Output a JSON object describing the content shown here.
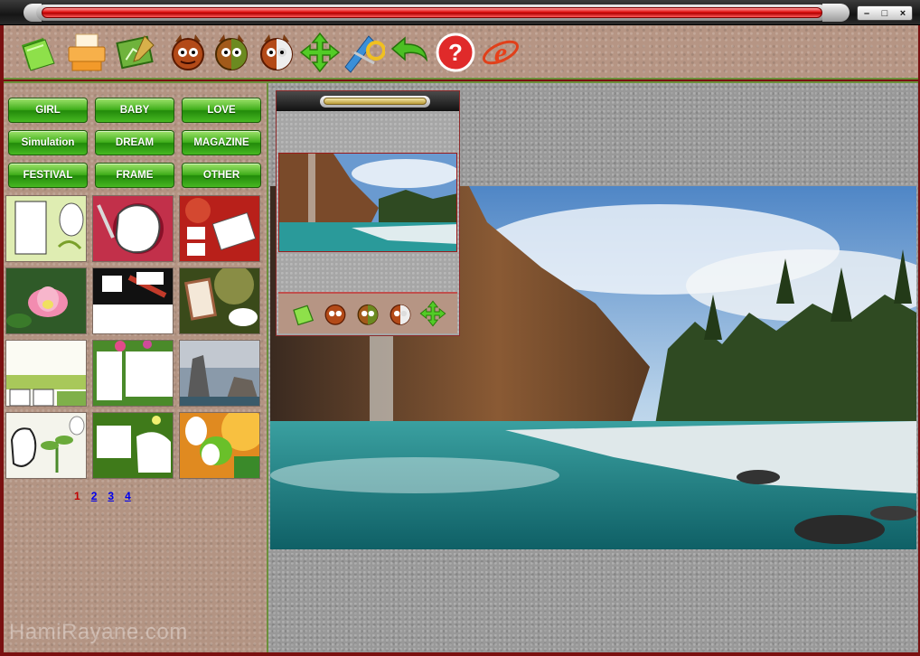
{
  "window": {
    "controls": {
      "minimize": "–",
      "maximize": "□",
      "close": "×"
    }
  },
  "toolbar": {
    "buttons": [
      {
        "id": "open",
        "icon": "folder-icon"
      },
      {
        "id": "print",
        "icon": "printer-icon"
      },
      {
        "id": "edit",
        "icon": "photo-edit-icon"
      },
      {
        "id": "face1",
        "icon": "devil-face-icon"
      },
      {
        "id": "face2",
        "icon": "devil-face-icon"
      },
      {
        "id": "face3",
        "icon": "devil-face-half-icon"
      },
      {
        "id": "move",
        "icon": "move-arrows-icon"
      },
      {
        "id": "tools",
        "icon": "ruler-icon"
      },
      {
        "id": "undo",
        "icon": "undo-arrow-icon"
      },
      {
        "id": "help",
        "icon": "help-icon"
      },
      {
        "id": "web",
        "icon": "internet-explorer-icon"
      }
    ]
  },
  "categories": [
    "GIRL",
    "BABY",
    "LOVE",
    "Simulation",
    "DREAM",
    "MAGAZINE",
    "FESTIVAL",
    "FRAME",
    "OTHER"
  ],
  "pager": {
    "current": "1",
    "pages": [
      "2",
      "3",
      "4"
    ]
  },
  "watermark": "HamiRayane.com",
  "colors": {
    "accent_red": "#e01010",
    "button_green": "#3fae1a",
    "panel_bg": "#b39483"
  }
}
